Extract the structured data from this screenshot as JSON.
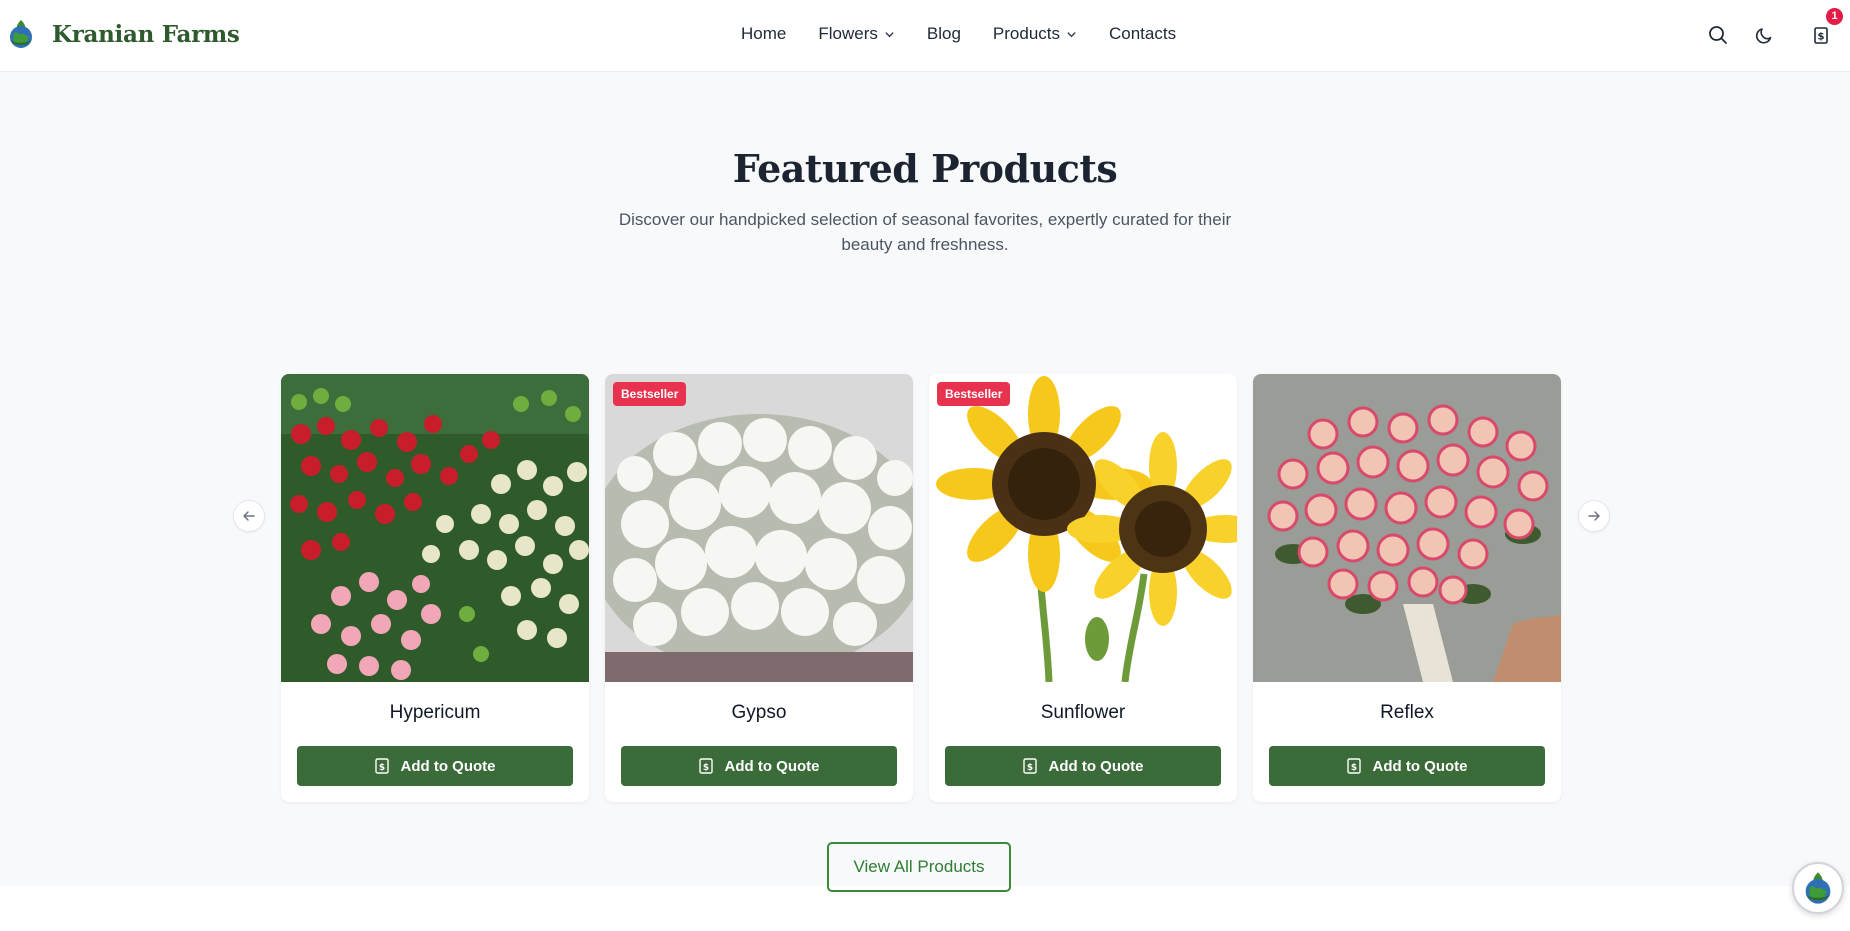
{
  "brand": {
    "name": "Kranian Farms",
    "logo_icon": "globe-flower-logo"
  },
  "nav": {
    "items": [
      {
        "label": "Home",
        "has_dropdown": false
      },
      {
        "label": "Flowers",
        "has_dropdown": true
      },
      {
        "label": "Blog",
        "has_dropdown": false
      },
      {
        "label": "Products",
        "has_dropdown": true
      },
      {
        "label": "Contacts",
        "has_dropdown": false
      }
    ]
  },
  "header_actions": {
    "search_icon": "search-icon",
    "theme_icon": "moon-icon",
    "quote_icon": "quote-list-icon",
    "quote_count": "1"
  },
  "featured": {
    "title": "Featured Products",
    "subtitle": "Discover our handpicked selection of seasonal favorites, expertly curated for their beauty and freshness.",
    "prev_icon": "arrow-left-icon",
    "next_icon": "arrow-right-icon",
    "products": [
      {
        "name": "Hypericum",
        "badge": "",
        "button": "Add to Quote"
      },
      {
        "name": "Gypso",
        "badge": "Bestseller",
        "button": "Add to Quote"
      },
      {
        "name": "Sunflower",
        "badge": "Bestseller",
        "button": "Add to Quote"
      },
      {
        "name": "Reflex",
        "badge": "",
        "button": "Add to Quote"
      }
    ],
    "view_all": "View All Products"
  },
  "colors": {
    "brand_green": "#3a6b39",
    "badge_red": "#e8334f",
    "section_bg": "#f8f9fa"
  }
}
